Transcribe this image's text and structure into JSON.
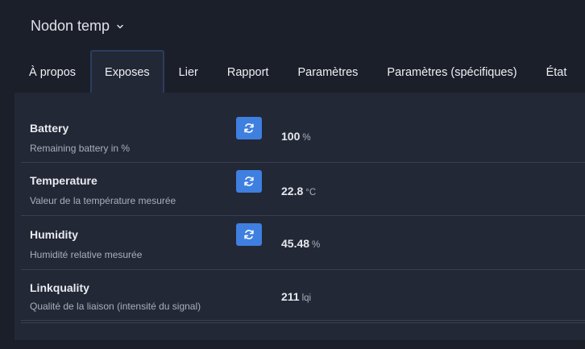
{
  "device": {
    "title": "Nodon temp"
  },
  "tabs": [
    {
      "label": "À propos"
    },
    {
      "label": "Exposes"
    },
    {
      "label": "Lier"
    },
    {
      "label": "Rapport"
    },
    {
      "label": "Paramètres"
    },
    {
      "label": "Paramètres (spécifiques)"
    },
    {
      "label": "État"
    }
  ],
  "active_tab": "Exposes",
  "exposes": [
    {
      "name": "Battery",
      "description": "Remaining battery in %",
      "value": "100",
      "unit": "%",
      "refresh": true
    },
    {
      "name": "Temperature",
      "description": "Valeur de la température mesurée",
      "value": "22.8",
      "unit": "°C",
      "refresh": true
    },
    {
      "name": "Humidity",
      "description": "Humidité relative mesurée",
      "value": "45.48",
      "unit": "%",
      "refresh": true
    },
    {
      "name": "Linkquality",
      "description": "Qualité de la liaison (intensité du signal)",
      "value": "211",
      "unit": "lqi",
      "refresh": false
    }
  ],
  "icons": {
    "dropdown": "chevron-down-icon",
    "refresh": "refresh-icon"
  },
  "colors": {
    "background": "#1b1f2a",
    "panel": "#232837",
    "accent": "#3f7fe0"
  }
}
